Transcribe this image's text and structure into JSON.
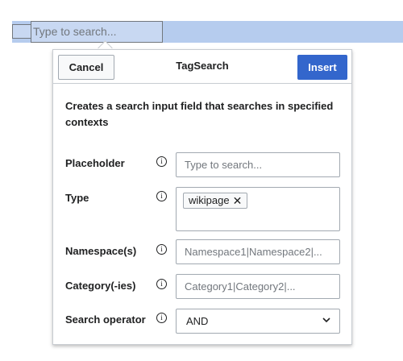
{
  "inline_search": {
    "placeholder": "Type to search..."
  },
  "dialog": {
    "title": "TagSearch",
    "cancel_label": "Cancel",
    "insert_label": "Insert",
    "description": "Creates a search input field that searches in specified contexts"
  },
  "fields": {
    "placeholder": {
      "label": "Placeholder",
      "value": "Type to search..."
    },
    "type": {
      "label": "Type",
      "tag": "wikipage"
    },
    "namespaces": {
      "label": "Namespace(s)",
      "placeholder": "Namespace1|Namespace2|..."
    },
    "categories": {
      "label": "Category(-ies)",
      "placeholder": "Category1|Category2|..."
    },
    "search_operator": {
      "label": "Search operator",
      "value": "AND"
    }
  },
  "icons": {
    "info": "i",
    "tag_remove": "✕"
  },
  "colors": {
    "accent": "#3366cc",
    "selection": "#b6ccee",
    "border": "#a2a9b1"
  }
}
